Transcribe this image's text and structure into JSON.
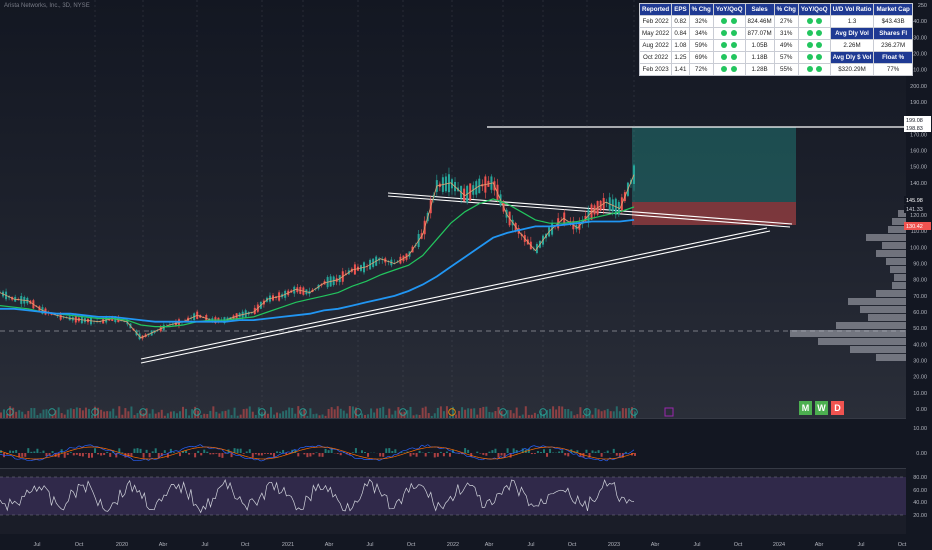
{
  "header": {
    "ticker_text": "Arista Networks, Inc., 3D, NYSE"
  },
  "fundamentals": {
    "headers": [
      "Reported",
      "EPS",
      "% Chg",
      "YoY/QoQ",
      "Sales",
      "% Chg",
      "YoY/QoQ"
    ],
    "rows": [
      [
        "Feb 2022",
        "0.82",
        "32%",
        "",
        "",
        "824.46M",
        "27%",
        "",
        ""
      ],
      [
        "May 2022",
        "0.84",
        "34%",
        "",
        "",
        "877.07M",
        "31%",
        "",
        ""
      ],
      [
        "Aug 2022",
        "1.08",
        "59%",
        "",
        "",
        "1.05B",
        "49%",
        "",
        ""
      ],
      [
        "Oct 2022",
        "1.25",
        "69%",
        "",
        "",
        "1.18B",
        "57%",
        "",
        ""
      ],
      [
        "Feb 2023",
        "1.41",
        "72%",
        "",
        "",
        "1.28B",
        "55%",
        "",
        ""
      ]
    ],
    "side": [
      [
        "U/D Vol Ratio",
        "Market Cap"
      ],
      [
        "1.3",
        "$43.43B"
      ],
      [
        "Avg Dly Vol",
        "Shares Fl"
      ],
      [
        "2.26M",
        "236.27M"
      ],
      [
        "Avg Dly $ Vol",
        "Float %"
      ],
      [
        "$320.29M",
        "77%"
      ]
    ]
  },
  "price_axis": {
    "ticks": [
      "250",
      "240.00",
      "230.00",
      "220.00",
      "210.00",
      "200.00",
      "190.00",
      "180.00",
      "170.00",
      "160.00",
      "150.00",
      "140.00",
      "130.00",
      "120.00",
      "110.00",
      "100.00",
      "90.00",
      "80.00",
      "70.00",
      "60.00",
      "50.00",
      "40.00",
      "30.00",
      "20.00",
      "10.00",
      "0.00"
    ],
    "labels": [
      {
        "text": "199.08",
        "bg": "#ffffff",
        "fg": "#131722"
      },
      {
        "text": "198.83",
        "bg": "#ffffff",
        "fg": "#131722"
      },
      {
        "text": "145.98",
        "bg": "#131722",
        "fg": "#ffffff"
      },
      {
        "text": "141.33",
        "bg": "#131722",
        "fg": "#d1d4dc"
      },
      {
        "text": "130.42",
        "bg": "#ef5350",
        "fg": "#ffffff"
      }
    ]
  },
  "osc_axis": {
    "ticks": [
      "10.00",
      "0.00"
    ]
  },
  "rsi_axis": {
    "ticks": [
      "80.00",
      "60.00",
      "40.00",
      "20.00"
    ]
  },
  "time_axis": {
    "ticks": [
      "Jul",
      "Oct",
      "2020",
      "Abr",
      "Jul",
      "Oct",
      "2021",
      "Abr",
      "Jul",
      "Oct",
      "2022",
      "Abr",
      "Jul",
      "Oct",
      "2023",
      "Abr",
      "Jul",
      "Oct",
      "2024",
      "Abr",
      "Jul",
      "Oct"
    ]
  },
  "timeframes": {
    "m": "M",
    "w": "W",
    "d": "D"
  },
  "colors": {
    "ma_fast": "#22c55e",
    "ma_slow": "#2196f3",
    "candle_up": "#26a69a",
    "candle_down": "#ef5350",
    "rsi_band": "#7e57c2"
  },
  "chart_data": {
    "type": "line",
    "title": "Arista Networks, Inc., 3D, NYSE",
    "x": [
      "2019-05",
      "2019-06",
      "2019-07",
      "2019-08",
      "2019-09",
      "2019-10",
      "2019-11",
      "2019-12",
      "2020-01",
      "2020-02",
      "2020-03",
      "2020-04",
      "2020-05",
      "2020-06",
      "2020-07",
      "2020-08",
      "2020-09",
      "2020-10",
      "2020-11",
      "2020-12",
      "2021-01",
      "2021-02",
      "2021-03",
      "2021-04",
      "2021-05",
      "2021-06",
      "2021-07",
      "2021-08",
      "2021-09",
      "2021-10",
      "2021-11",
      "2021-12",
      "2022-01",
      "2022-02",
      "2022-03",
      "2022-04",
      "2022-05",
      "2022-06",
      "2022-07",
      "2022-08",
      "2022-09",
      "2022-10",
      "2022-11",
      "2022-12",
      "2023-01",
      "2023-02"
    ],
    "series": [
      {
        "values": [
          72,
          68,
          67,
          61,
          58,
          56,
          55,
          54,
          56,
          54,
          44,
          48,
          52,
          54,
          58,
          55,
          55,
          58,
          60,
          68,
          70,
          74,
          72,
          78,
          80,
          86,
          88,
          93,
          90,
          95,
          108,
          138,
          140,
          132,
          138,
          140,
          120,
          108,
          98,
          110,
          118,
          112,
          122,
          128,
          124,
          145
        ]
      },
      {
        "values": [
          64,
          63,
          62,
          60,
          59,
          58,
          57,
          56,
          56,
          55,
          52,
          51,
          51,
          52,
          54,
          55,
          55,
          56,
          57,
          60,
          63,
          66,
          68,
          70,
          72,
          76,
          79,
          83,
          86,
          89,
          95,
          105,
          115,
          122,
          127,
          130,
          127,
          122,
          117,
          115,
          115,
          116,
          118,
          120,
          122,
          125
        ]
      },
      {
        "values": [
          62,
          62,
          61,
          60,
          59,
          59,
          58,
          57,
          57,
          56,
          55,
          54,
          54,
          54,
          54,
          54,
          54,
          55,
          55,
          56,
          57,
          58,
          59,
          61,
          62,
          64,
          66,
          68,
          70,
          73,
          77,
          82,
          88,
          94,
          100,
          106,
          109,
          111,
          113,
          113,
          114,
          115,
          116,
          116,
          116,
          117
        ]
      }
    ],
    "ylim": [
      0,
      250
    ],
    "annotations": [
      "199.08",
      "198.83",
      "145.98",
      "141.33",
      "130.42"
    ]
  }
}
